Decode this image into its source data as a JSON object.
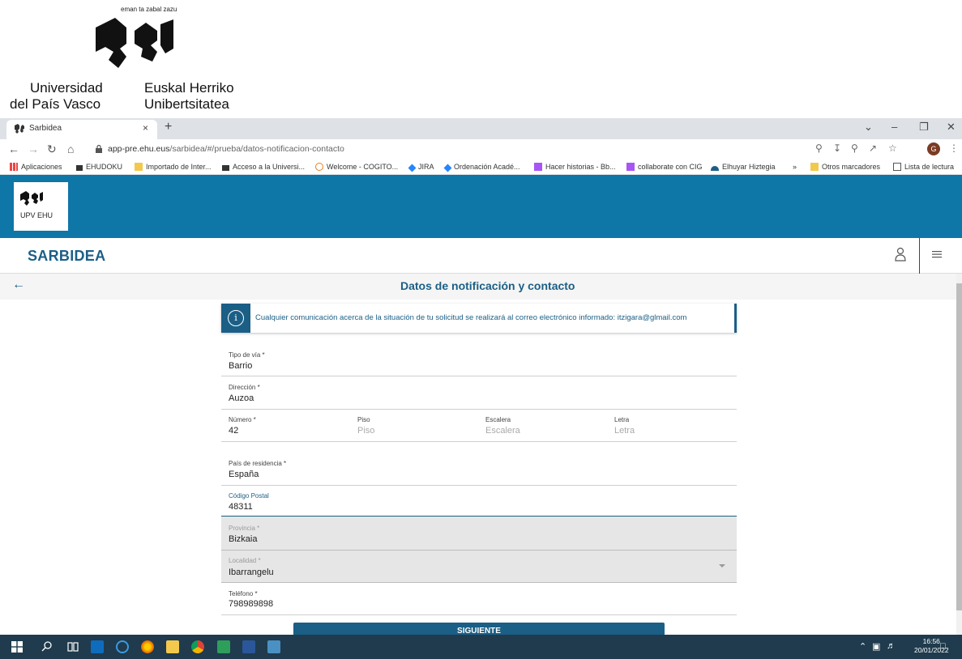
{
  "letterhead": {
    "motto": "eman ta zabal zazu",
    "name_es_line1": "Universidad",
    "name_es_line2": "del País Vasco",
    "name_eu_line1": "Euskal Herriko",
    "name_eu_line2": "Unibertsitatea"
  },
  "browser": {
    "tab_title": "Sarbidea",
    "tab_close": "×",
    "new_tab": "+",
    "url_host": "app-pre.ehu.eus",
    "url_path": "/sarbidea/#/prueba/datos-notificacion-contacto",
    "profile_initial": "G",
    "bookmarks": [
      "Aplicaciones",
      "EHUDOKU",
      "Importado de Inter...",
      "Acceso a la Universi...",
      "Welcome - COGITO...",
      "JIRA",
      "Ordenación Acadé...",
      "Hacer historias - Bb...",
      "collaborate con CIG",
      "Elhuyar Hiztegia",
      "»",
      "Otros marcadores",
      "Lista de lectura"
    ]
  },
  "app": {
    "logo_text": "UPV   EHU",
    "brand": "SARBIDEA",
    "page_title": "Datos de notificación y contacto",
    "info_message": "Cualquier comunicación acerca de la situación de tu solicitud se realizará al correo electrónico informado: itzigara@glmail.com",
    "fields": {
      "tipo_via": {
        "label": "Tipo de vía *",
        "value": "Barrio"
      },
      "direccion": {
        "label": "Dirección *",
        "value": "Auzoa"
      },
      "numero": {
        "label": "Número *",
        "value": "42"
      },
      "piso": {
        "label": "Piso",
        "placeholder": "Piso"
      },
      "escalera": {
        "label": "Escalera",
        "placeholder": "Escalera"
      },
      "letra": {
        "label": "Letra",
        "placeholder": "Letra"
      },
      "pais": {
        "label": "País de residencia *",
        "value": "España"
      },
      "codigo_postal": {
        "label": "Código Postal",
        "value": "48311"
      },
      "provincia": {
        "label": "Provincia *",
        "value": "Bizkaia"
      },
      "localidad": {
        "label": "Localidad *",
        "value": "Ibarrangelu"
      },
      "telefono": {
        "label": "Teléfono *",
        "value": "798989898"
      }
    },
    "next_button": "SIGUIENTE"
  },
  "taskbar": {
    "time": "16:56",
    "date": "20/01/2022"
  },
  "colors": {
    "brand_blue": "#1b5f86",
    "banner_blue": "#0f76a8",
    "taskbar": "#1f3b4d"
  }
}
